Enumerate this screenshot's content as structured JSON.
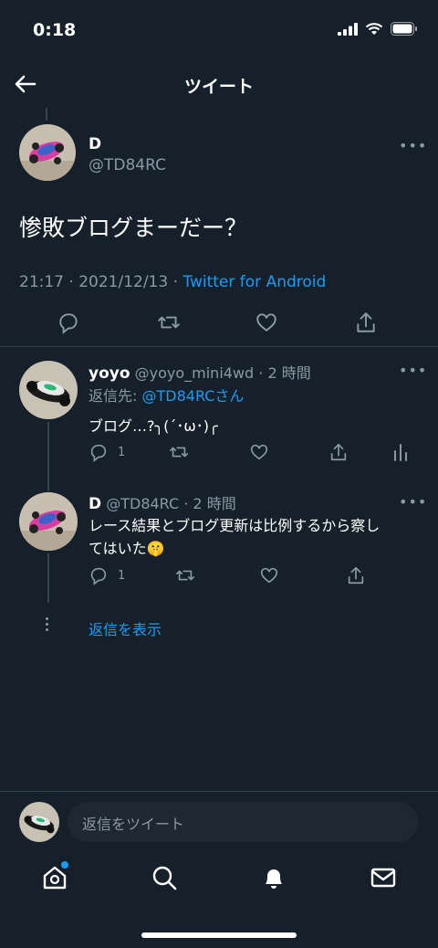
{
  "status_bar": {
    "time": "0:18"
  },
  "header": {
    "title": "ツイート"
  },
  "main_tweet": {
    "name": "D",
    "handle": "@TD84RC",
    "text": "惨敗ブログまーだー？",
    "timestamp": "21:17 · 2021/12/13 · ",
    "source": "Twitter for Android"
  },
  "replies": [
    {
      "name": "yoyo",
      "handle_time": "@yoyo_mini4wd · 2 時間",
      "reply_to_prefix": "返信先: ",
      "reply_to_target": "@TD84RCさん",
      "text": "ブログ…?╮(´･ω･)╭",
      "reply_count": "1"
    },
    {
      "name": "D",
      "handle_time": "@TD84RC · 2 時間",
      "text_line1": "レース結果とブログ更新は比例するから察し",
      "text_line2": "てはいた",
      "emoji": "🤫",
      "reply_count": "1"
    }
  ],
  "show_replies": "返信を表示",
  "compose": {
    "placeholder": "返信をツイート"
  },
  "colors": {
    "background": "#15202b",
    "accent": "#1d9bf0",
    "muted": "#8b98a5",
    "divider": "#38444d"
  }
}
